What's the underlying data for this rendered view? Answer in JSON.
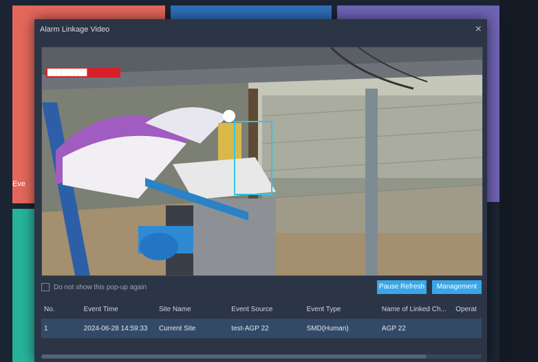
{
  "background": {
    "side_label": "Eve",
    "colors": {
      "red": "#e4675c",
      "blue": "#2f6fb8",
      "purple": "#6f63b5",
      "green": "#27b39a"
    }
  },
  "dialog": {
    "title": "Alarm Linkage Video",
    "close_icon": "×"
  },
  "video": {
    "overlay_text": "█████████"
  },
  "controls": {
    "checkbox_label": "Do not show this pop-up again",
    "pause_button": "Pause Refresh",
    "management_button": "Management"
  },
  "table": {
    "columns": [
      "No.",
      "Event Time",
      "Site Name",
      "Event Source",
      "Event Type",
      "Name of Linked Ch...",
      "Operat"
    ],
    "rows": [
      [
        "1",
        "2024-06-28 14:59:33",
        "Current Site",
        "test-AGP 22",
        "SMD(Human)",
        "AGP 22",
        ""
      ]
    ]
  },
  "accent_color": "#3aa6e8"
}
